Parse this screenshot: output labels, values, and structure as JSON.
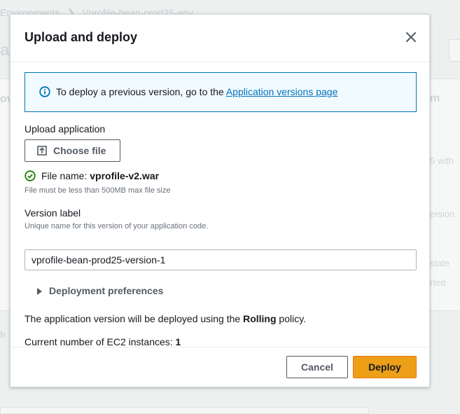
{
  "background": {
    "breadcrumb": [
      "Environments",
      "Vprofile-bean-prod25-env"
    ],
    "page_title_fragment": "a",
    "side_fragments": [
      "ov",
      "m",
      "5 with",
      "ersion",
      "state",
      "rted",
      "h"
    ]
  },
  "modal": {
    "title": "Upload and deploy",
    "close_icon": "close-icon",
    "info": {
      "icon": "info-icon",
      "text": "To deploy a previous version, go to the ",
      "link": "Application versions page"
    },
    "upload": {
      "label": "Upload application",
      "button_label": "Choose file",
      "button_icon": "upload-icon",
      "status_icon": "check-circle-icon",
      "file_name_label": "File name: ",
      "file_name": "vprofile-v2.war",
      "constraint": "File must be less than 500MB max file size"
    },
    "version": {
      "label": "Version label",
      "description": "Unique name for this version of your application code.",
      "value": "vprofile-bean-prod25-version-1"
    },
    "preferences": {
      "label": "Deployment preferences",
      "icon": "caret-right-icon"
    },
    "policy": {
      "prefix": "The application version will be deployed using the ",
      "policy": "Rolling",
      "suffix": " policy."
    },
    "instances": {
      "label": "Current number of EC2 instances: ",
      "count": "1"
    },
    "footer": {
      "cancel_label": "Cancel",
      "deploy_label": "Deploy"
    }
  },
  "colors": {
    "link": "#0073bb",
    "info_bg": "#f1faff",
    "primary": "#ec9f17",
    "success": "#1d8102",
    "text": "#16191f",
    "secondary_text": "#687078"
  }
}
